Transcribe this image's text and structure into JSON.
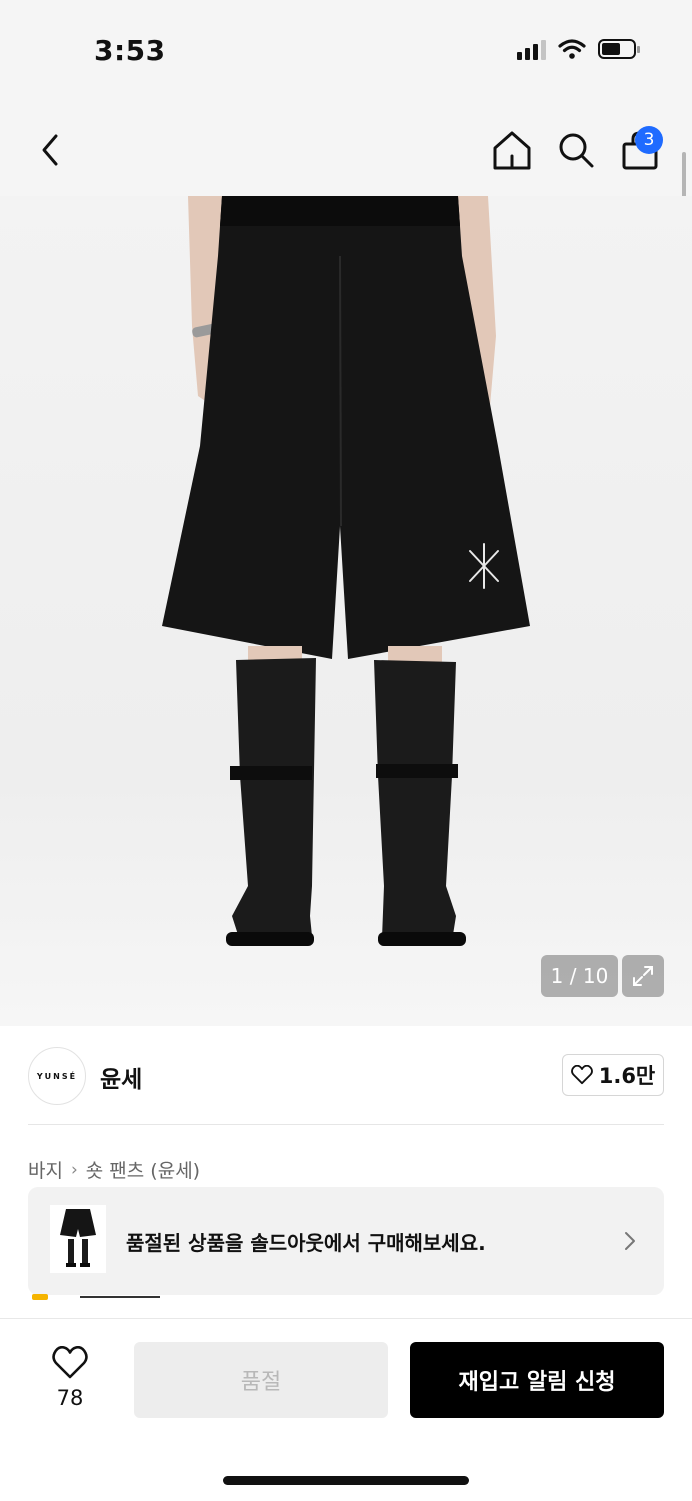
{
  "status_bar": {
    "time": "3:53"
  },
  "header": {
    "cart_count": "3",
    "icons": [
      "back-arrow-icon",
      "home-icon",
      "search-icon",
      "shopping-bag-icon"
    ]
  },
  "gallery": {
    "counter": "1 / 10"
  },
  "brand": {
    "logo_text": "YUNSÉ",
    "name": "윤세",
    "like_count": "1.6만"
  },
  "breadcrumb": {
    "category": "바지",
    "subcategory": "숏 팬츠 (윤세)"
  },
  "soldout_banner": {
    "text": "품절된 상품을 솔드아웃에서 구매해보세요."
  },
  "bottom_bar": {
    "wish_count": "78",
    "soldout_label": "품절",
    "restock_label": "재입고 알림 신청"
  },
  "colors": {
    "accent_badge": "#1f6bff",
    "primary_button": "#000000",
    "disabled_button": "#ededed"
  }
}
